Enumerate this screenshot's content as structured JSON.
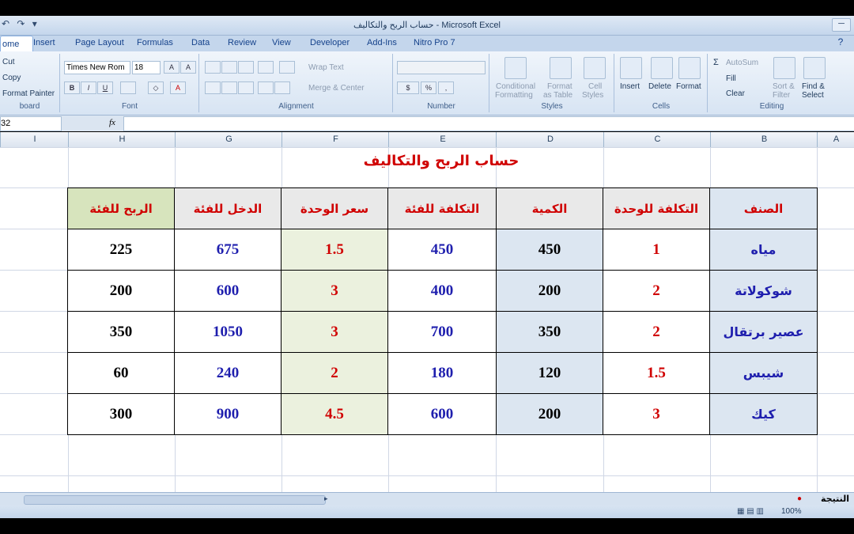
{
  "window": {
    "title": "حساب الربح والتكاليف - Microsoft Excel",
    "qat_symbols": "↶ ↷ ▾",
    "minimize_symbol": "─"
  },
  "tabs": [
    "ome",
    "Insert",
    "Page Layout",
    "Formulas",
    "Data",
    "Review",
    "View",
    "Developer",
    "Add-Ins",
    "Nitro Pro 7"
  ],
  "ribbon": {
    "clipboard": {
      "cut": "Cut",
      "copy": "Copy",
      "format_painter": "Format Painter",
      "label": "board"
    },
    "font": {
      "name": "Times New Rom",
      "size": "18",
      "label": "Font",
      "grow": "A",
      "shrink": "A",
      "bold": "B",
      "italic": "I",
      "underline": "U",
      "fill": "◇",
      "color": "A"
    },
    "alignment": {
      "wrap_text": "Wrap Text",
      "merge_center": "Merge & Center",
      "label": "Alignment"
    },
    "number": {
      "currency": "$",
      "percent": "%",
      "comma": ",",
      "label": "Number"
    },
    "styles": {
      "conditional": "Conditional",
      "conditional2": "Formatting",
      "format_as": "Format",
      "format_as2": "as Table",
      "cell": "Cell",
      "cell2": "Styles",
      "label": "Styles"
    },
    "cells": {
      "insert": "Insert",
      "delete": "Delete",
      "format": "Format",
      "label": "Cells"
    },
    "editing": {
      "autosum": "AutoSum",
      "fill": "Fill",
      "clear": "Clear",
      "sort": "Sort &",
      "sort2": "Filter",
      "find": "Find &",
      "find2": "Select",
      "label": "Editing"
    },
    "help_symbol": "?"
  },
  "formula_bar": {
    "name_box": "32",
    "fx": "fx",
    "value": ""
  },
  "columns": [
    "I",
    "H",
    "G",
    "F",
    "E",
    "D",
    "C",
    "B",
    "A"
  ],
  "sheet_title": "حساب الربح والتكاليف",
  "table": {
    "headers": [
      "الربح للفئة",
      "الدخل للفئة",
      "سعر الوحدة",
      "التكلفة للفئة",
      "الكمية",
      "التكلفة للوحدة",
      "الصنف"
    ],
    "rows": [
      [
        "225",
        "675",
        "1.5",
        "450",
        "450",
        "1",
        "مياه"
      ],
      [
        "200",
        "600",
        "3",
        "400",
        "200",
        "2",
        "شوكولاتة"
      ],
      [
        "350",
        "1050",
        "3",
        "700",
        "350",
        "2",
        "عصير برتقال"
      ],
      [
        "60",
        "240",
        "2",
        "180",
        "120",
        "1.5",
        "شيبس"
      ],
      [
        "300",
        "900",
        "4.5",
        "600",
        "200",
        "3",
        "كيك"
      ]
    ]
  },
  "colors": {
    "title": "#d00000",
    "red": "#d00000",
    "blue": "#1f1fae",
    "black": "#000000",
    "green_fill": "#d7e4bd",
    "header_green": "#d7e4bd",
    "header_gray": "#e9e9e9",
    "blue_fill": "#dce6f1",
    "light_green": "#ebf1de"
  },
  "sheet_tabs": [
    "النتيجة"
  ],
  "status": {
    "zoom": "100%"
  }
}
